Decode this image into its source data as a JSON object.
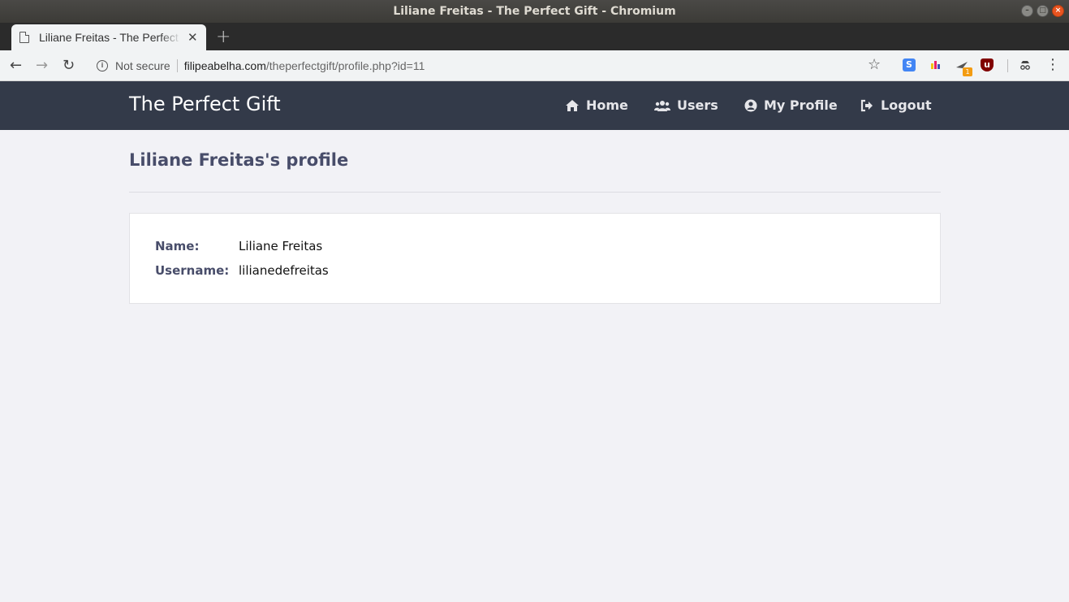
{
  "window": {
    "title": "Liliane Freitas - The Perfect Gift - Chromium"
  },
  "browser": {
    "tab_title": "Liliane Freitas - The Perfect Gift",
    "security_label": "Not secure",
    "url_host": "filipeabelha.com",
    "url_path": "/theperfectgift/profile.php?id=11",
    "extension_badge": "1"
  },
  "site": {
    "brand": "The Perfect Gift",
    "nav": [
      {
        "label": "Home",
        "icon": "home-icon"
      },
      {
        "label": "Users",
        "icon": "users-icon"
      },
      {
        "label": "My Profile",
        "icon": "user-circle-icon"
      },
      {
        "label": "Logout",
        "icon": "sign-out-icon"
      }
    ]
  },
  "profile": {
    "heading": "Liliane Freitas's profile",
    "fields": [
      {
        "label": "Name:",
        "value": "Liliane Freitas"
      },
      {
        "label": "Username:",
        "value": "lilianedefreitas"
      }
    ]
  },
  "colors": {
    "navbar": "#333a49",
    "heading": "#484d6a",
    "page_bg": "#f2f2f6"
  }
}
